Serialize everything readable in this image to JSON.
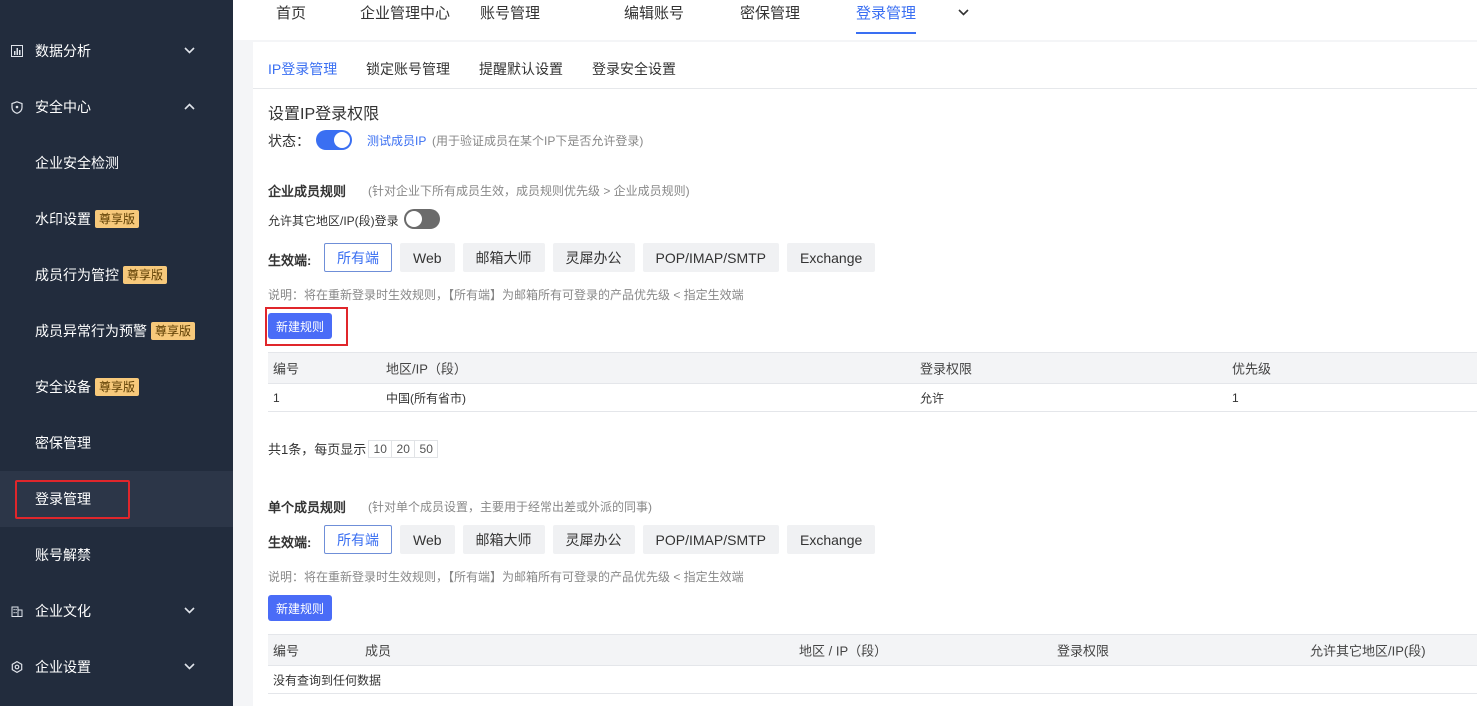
{
  "sidebar": {
    "groups": [
      {
        "label": "数据分析",
        "icon": "chart-icon",
        "chevron": "down"
      },
      {
        "label": "安全中心",
        "icon": "shield-icon",
        "chevron": "up"
      },
      {
        "label": "企业文化",
        "icon": "building-icon",
        "chevron": "down"
      },
      {
        "label": "企业设置",
        "icon": "gear-icon",
        "chevron": "down"
      }
    ],
    "security_items": [
      {
        "label": "企业安全检测",
        "badge": ""
      },
      {
        "label": "水印设置",
        "badge": "尊享版"
      },
      {
        "label": "成员行为管控",
        "badge": "尊享版"
      },
      {
        "label": "成员异常行为预警",
        "badge": "尊享版"
      },
      {
        "label": "安全设备",
        "badge": "尊享版"
      },
      {
        "label": "密保管理",
        "badge": ""
      },
      {
        "label": "登录管理",
        "badge": "",
        "active": true
      },
      {
        "label": "账号解禁",
        "badge": ""
      }
    ]
  },
  "topnav": {
    "tabs": [
      "首页",
      "企业管理中心",
      "账号管理",
      "编辑账号",
      "密保管理",
      "登录管理"
    ],
    "active": "登录管理",
    "more_icon": "chevron-down-icon"
  },
  "subtabs": {
    "items": [
      "IP登录管理",
      "锁定账号管理",
      "提醒默认设置",
      "登录安全设置"
    ],
    "active": "IP登录管理"
  },
  "ip_section": {
    "title": "设置IP登录权限",
    "status_label": "状态：",
    "status_on": true,
    "test_link": "测试成员IP",
    "test_hint": "(用于验证成员在某个IP下是否允许登录)"
  },
  "enterprise_rules": {
    "title": "企业成员规则",
    "hint": "(针对企业下所有成员生效，成员规则优先级 > 企业成员规则)",
    "allow_other_label": "允许其它地区/IP(段)登录",
    "allow_other_on": false,
    "platform_label": "生效端:",
    "platforms": [
      "所有端",
      "Web",
      "邮箱大师",
      "灵犀办公",
      "POP/IMAP/SMTP",
      "Exchange"
    ],
    "selected_platform": "所有端",
    "note": "说明：将在重新登录时生效规则，【所有端】为邮箱所有可登录的产品优先级 < 指定生效端",
    "new_rule_button": "新建规则",
    "table": {
      "headers": [
        "编号",
        "地区/IP（段）",
        "登录权限",
        "优先级"
      ],
      "rows": [
        [
          "1",
          "中国(所有省市)",
          "允许",
          "1"
        ]
      ]
    },
    "pagination": {
      "summary": "共1条，每页显示",
      "sizes": [
        "10",
        "20",
        "50"
      ]
    }
  },
  "member_rules": {
    "title": "单个成员规则",
    "hint": "(针对单个成员设置，主要用于经常出差或外派的同事)",
    "platform_label": "生效端:",
    "platforms": [
      "所有端",
      "Web",
      "邮箱大师",
      "灵犀办公",
      "POP/IMAP/SMTP",
      "Exchange"
    ],
    "selected_platform": "所有端",
    "note": "说明：将在重新登录时生效规则，【所有端】为邮箱所有可登录的产品优先级 < 指定生效端",
    "new_rule_button": "新建规则",
    "table": {
      "headers": [
        "编号",
        "成员",
        "地区 / IP（段）",
        "登录权限",
        "允许其它地区/IP(段)"
      ],
      "empty_text": "没有查询到任何数据"
    }
  },
  "colors": {
    "sidebar_bg": "#222c3d",
    "accent": "#3a6ff2",
    "button": "#4a6cf7",
    "badge": "#f7c97b",
    "highlight_border": "#e0262b"
  }
}
